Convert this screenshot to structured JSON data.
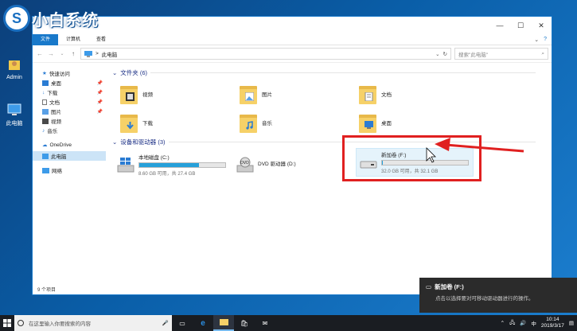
{
  "logo": {
    "text": "小白系统"
  },
  "desktop": {
    "admin_label": "Admin",
    "pc_label": "此电脑"
  },
  "window": {
    "ribbon_tabs": [
      "文件",
      "计算机",
      "查看"
    ],
    "address_path": "此电脑",
    "address_chevron": ">",
    "search_placeholder": "搜索\"此电脑\"",
    "status_text": "9 个项目"
  },
  "sidebar": {
    "quick_access": "快速访问",
    "items": [
      {
        "label": "桌面",
        "icon": "desktop-icon",
        "color": "#2b7cd3",
        "pinned": true
      },
      {
        "label": "下载",
        "icon": "download-icon",
        "color": "#2b7cd3",
        "pinned": true
      },
      {
        "label": "文档",
        "icon": "document-icon",
        "color": "#4a4a4a",
        "pinned": true
      },
      {
        "label": "图片",
        "icon": "pictures-icon",
        "color": "#2b7cd3",
        "pinned": true
      },
      {
        "label": "视频",
        "icon": "video-icon",
        "color": "#4a4a4a",
        "pinned": false
      },
      {
        "label": "音乐",
        "icon": "music-icon",
        "color": "#2b7cd3",
        "pinned": false
      }
    ],
    "onedrive": "OneDrive",
    "this_pc": "此电脑",
    "network": "网络"
  },
  "folders_section": {
    "title": "文件夹 (6)"
  },
  "folders": [
    {
      "label": "视频",
      "icon": "video-folder-icon"
    },
    {
      "label": "图片",
      "icon": "pictures-folder-icon"
    },
    {
      "label": "文档",
      "icon": "documents-folder-icon"
    },
    {
      "label": "下载",
      "icon": "downloads-folder-icon"
    },
    {
      "label": "音乐",
      "icon": "music-folder-icon"
    },
    {
      "label": "桌面",
      "icon": "desktop-folder-icon"
    }
  ],
  "drives_section": {
    "title": "设备和驱动器 (3)"
  },
  "drives": [
    {
      "label": "本地磁盘 (C:)",
      "free": "8.60 GB 可用，共 27.4 GB",
      "used_fraction": 0.69,
      "icon": "windows-drive-icon"
    },
    {
      "label": "DVD 驱动器 (D:)",
      "icon": "dvd-drive-icon"
    },
    {
      "label": "新加卷 (F:)",
      "free": "32.0 GB 可用，共 32.1 GB",
      "used_fraction": 0.003,
      "icon": "removable-drive-icon"
    }
  ],
  "notification": {
    "title": "新加卷 (F:)",
    "body": "点击以选择要对可移动驱动器进行的操作。"
  },
  "taskbar": {
    "search_placeholder": "在这里输入你要搜索的内容",
    "time": "10:14",
    "date": "2019/3/17"
  }
}
